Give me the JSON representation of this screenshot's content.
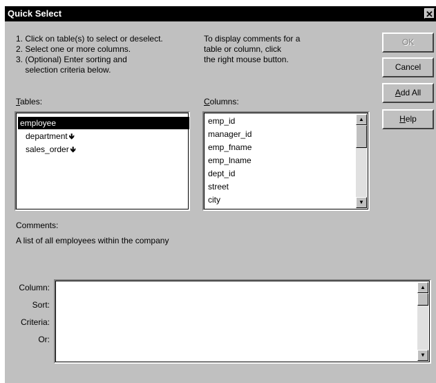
{
  "window": {
    "title": "Quick Select",
    "close_glyph": "✕"
  },
  "instructions": {
    "line1": "1. Click on table(s) to select or deselect.",
    "line2": "2. Select one or more columns.",
    "line3": "3. (Optional) Enter sorting and",
    "line4": "    selection criteria below."
  },
  "hint": {
    "line1": "To display comments for a",
    "line2": "table or column, click",
    "line3": "the right mouse button."
  },
  "buttons": {
    "ok": "OK",
    "cancel": "Cancel",
    "add_all_mnemonic": "A",
    "add_all_rest": "dd All",
    "help_mnemonic": "H",
    "help_rest": "elp"
  },
  "tables": {
    "label_mnemonic": "T",
    "label_rest": "ables:",
    "items": [
      {
        "label": "employee",
        "selected": true,
        "arrow": ""
      },
      {
        "label": "department",
        "selected": false,
        "arrow": "🡻"
      },
      {
        "label": "sales_order",
        "selected": false,
        "arrow": "🡻"
      }
    ]
  },
  "columns": {
    "label_mnemonic": "C",
    "label_rest": "olumns:",
    "items": [
      "emp_id",
      "manager_id",
      "emp_fname",
      "emp_lname",
      "dept_id",
      "street",
      "city"
    ]
  },
  "comments": {
    "label": "Comments:",
    "text": "A list of all employees within the company"
  },
  "criteria": {
    "column_label": "Column:",
    "sort_label": "Sort:",
    "criteria_label": "Criteria:",
    "or_label": "Or:"
  },
  "icons": {
    "scroll_up": "▲",
    "scroll_down": "▼",
    "related_arrow": "down-arrow-icon"
  }
}
